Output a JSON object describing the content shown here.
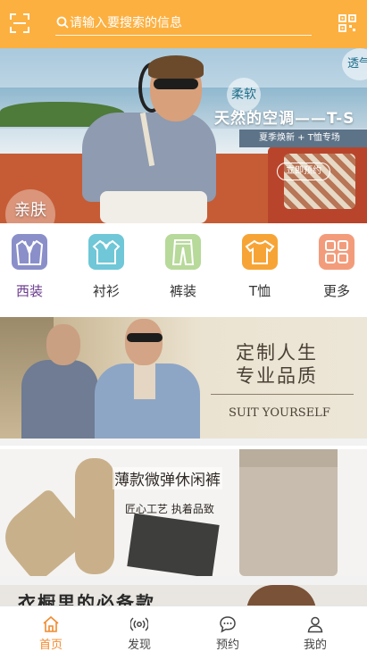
{
  "header": {
    "search_placeholder": "请输入要搜索的信息",
    "accent_color": "#fcb040"
  },
  "hero": {
    "tag_soft": "柔软",
    "tag_breath": "透气",
    "title": "天然的空调——T-S",
    "subtitle": "夏季焕新 + T恤专场",
    "button": "立即预约",
    "tag_skin": "亲肤"
  },
  "categories": [
    {
      "label": "西装",
      "icon": "suit-icon",
      "color": "#8a8fc9",
      "active": true
    },
    {
      "label": "衬衫",
      "icon": "shirt-icon",
      "color": "#6fc7d7",
      "active": false
    },
    {
      "label": "裤装",
      "icon": "pants-icon",
      "color": "#b7d99a",
      "active": false
    },
    {
      "label": "T恤",
      "icon": "tshirt-icon",
      "color": "#f7a436",
      "active": false
    },
    {
      "label": "更多",
      "icon": "more-icon",
      "color": "#f39c7b",
      "active": false
    }
  ],
  "banners": {
    "suit": {
      "line1": "定制人生",
      "line2": "专业品质",
      "line3": "SUIT YOURSELF"
    },
    "pants": {
      "line1": "薄款微弹休闲裤",
      "line2": "匠心工艺  执着品致"
    },
    "third": {
      "line1": "衣橱里的必备款"
    }
  },
  "tabbar": [
    {
      "label": "首页",
      "icon": "home-icon",
      "active": true
    },
    {
      "label": "发现",
      "icon": "broadcast-icon",
      "active": false
    },
    {
      "label": "预约",
      "icon": "chat-icon",
      "active": false
    },
    {
      "label": "我的",
      "icon": "user-icon",
      "active": false
    }
  ]
}
